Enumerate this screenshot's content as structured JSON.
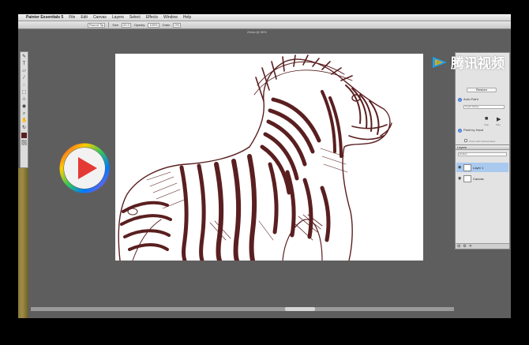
{
  "menubar": {
    "app_name": "Painter Essentials 5",
    "items": [
      "File",
      "Edit",
      "Canvas",
      "Layers",
      "Select",
      "Effects",
      "Window",
      "Help"
    ]
  },
  "propbar": {
    "brush_field": "Round Tip",
    "size_label": "Size",
    "size_value": "20.0",
    "opacity_label": "Opacity",
    "opacity_value": "100%",
    "grain_label": "Grain",
    "grain_value": "0%"
  },
  "document_title": "Zebra @ 50%",
  "watermark": {
    "text": "腾讯视频"
  },
  "auto_paint_panel": {
    "button_top": "Restore",
    "step1_title": "Auto-Paint",
    "step1_field": "Smart Stroke",
    "step2_title": "Paint by Hand",
    "play_label": "Play",
    "stop_label": "Stop",
    "check1_label": "Clone with Tracing Paper",
    "check2_label": "Show tracing paper"
  },
  "layers_panel": {
    "title": "Layers",
    "composite_label": "Default",
    "layers": [
      {
        "name": "Layer 1",
        "selected": true
      },
      {
        "name": "Canvas",
        "selected": false
      }
    ]
  },
  "colors": {
    "sketch": "#5a1f20",
    "selection": "#a9c9ee",
    "accent": "#3b78d8"
  }
}
